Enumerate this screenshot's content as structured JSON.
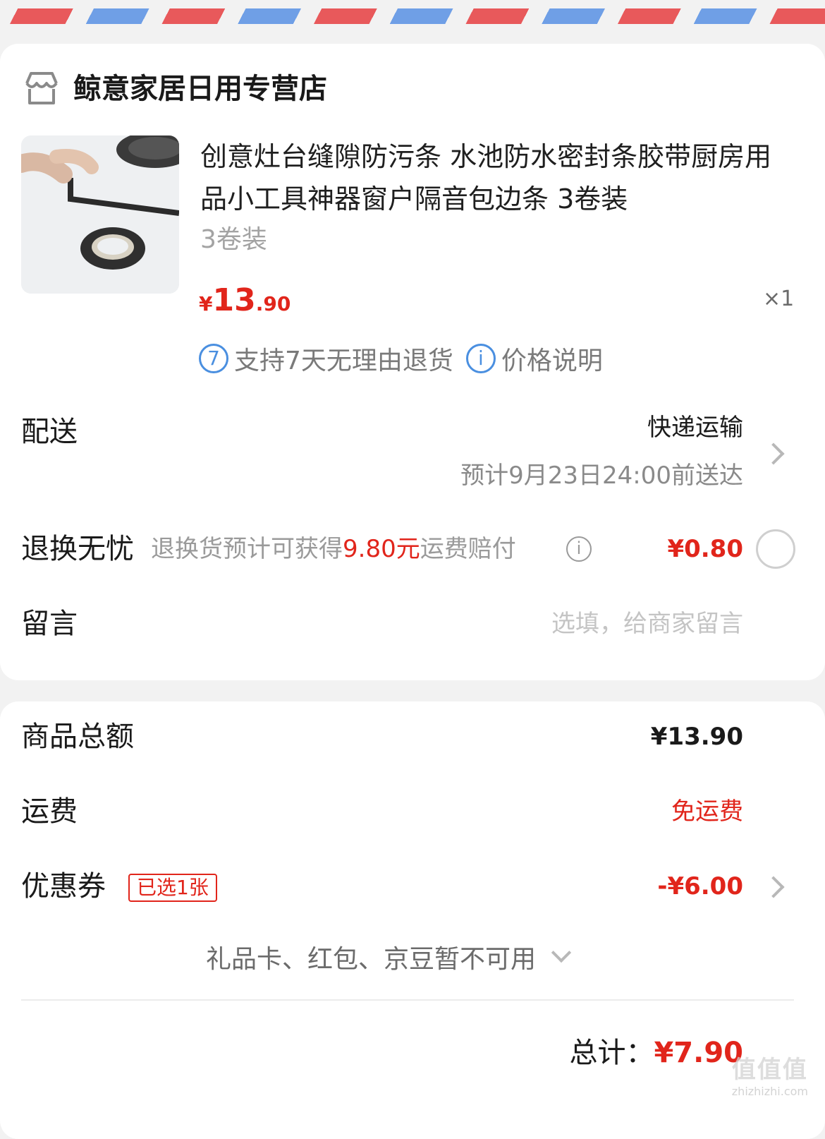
{
  "store": {
    "name": "鲸意家居日用专营店",
    "icon": "store-icon"
  },
  "product": {
    "title": "创意灶台缝隙防污条 水池防水密封条胶带厨房用品小工具神器窗户隔音包边条 3卷装",
    "spec": "3卷装",
    "price_symbol": "¥",
    "price_int": "13",
    "price_dec": ".90",
    "quantity": "×1",
    "tags": [
      {
        "icon_text": "7",
        "icon": "seven-day-return-icon",
        "label": "支持7天无理由退货"
      },
      {
        "icon_text": "i",
        "icon": "info-icon",
        "label": "价格说明"
      }
    ]
  },
  "delivery": {
    "label": "配送",
    "method": "快递运输",
    "eta": "预计9月23日24:00前送达"
  },
  "return_worry_free": {
    "label": "退换无忧",
    "desc_prefix": "退换货预计可获得",
    "desc_amount": "9.80元",
    "desc_suffix": "运费赔付",
    "price": "¥0.80"
  },
  "message": {
    "label": "留言",
    "placeholder": "选填，给商家留言"
  },
  "summary": {
    "goods_total_label": "商品总额",
    "goods_total_value": "¥13.90",
    "shipping_label": "运费",
    "shipping_value": "免运费",
    "coupon_label": "优惠券",
    "coupon_badge": "已选1张",
    "coupon_value": "-¥6.00",
    "unavailable_text": "礼品卡、红包、京豆暂不可用",
    "total_label": "总计：",
    "total_value": "¥7.90"
  },
  "watermark": {
    "main": "值值值",
    "sub": "zhizhizhi.com"
  },
  "colors": {
    "accent_red": "#e1251b",
    "info_blue": "#4a8fe0",
    "airmail_red": "#e8595b",
    "airmail_blue": "#6f9fe6"
  }
}
